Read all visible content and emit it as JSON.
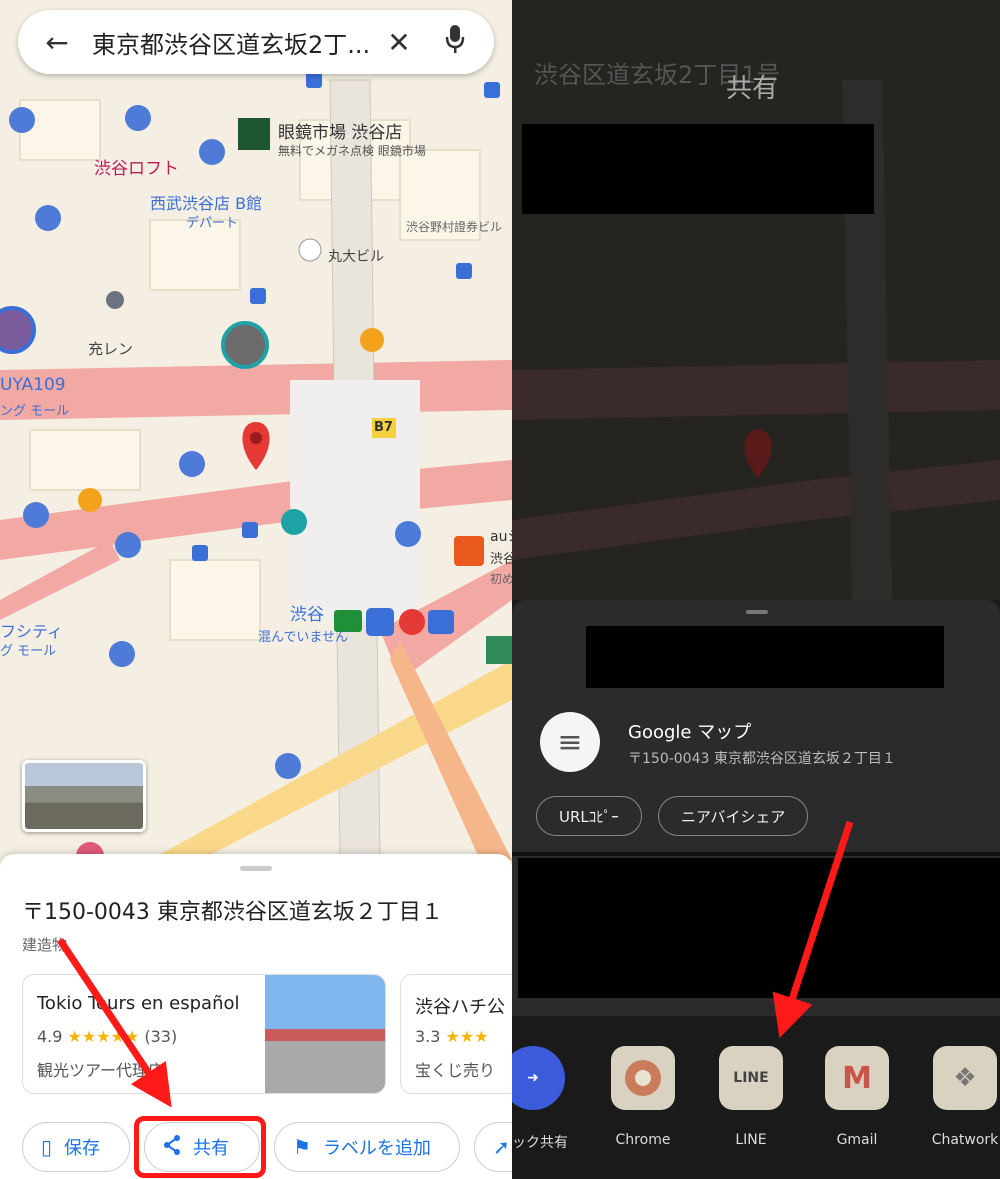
{
  "left": {
    "search": {
      "query": "東京都渋谷区道玄坂2丁...",
      "back_icon": "←",
      "clear_icon": "✕",
      "mic_icon": "🎙"
    },
    "map_labels": [
      "眼鏡市場 渋谷店",
      "無料でメガネ点検 眼鏡市場",
      "渋谷ロフト",
      "西武渋谷店 B館",
      "デパート",
      "丸大ビル",
      "渋谷野村證券ビル",
      "充レン",
      "UYA109",
      "ング モール",
      "B7",
      "auシティ店",
      "渋谷グス・会議取",
      "初めます",
      "渋谷",
      "混んでいません",
      "フシティ",
      "グ モール"
    ],
    "place": {
      "address": "〒150-0043 東京都渋谷区道玄坂２丁目１",
      "type": "建造物",
      "cards": [
        {
          "title": "Tokio Tours en español",
          "rating": "4.9",
          "stars": "★★★★★",
          "count": "(33)",
          "sub": "観光ツアー代理店"
        },
        {
          "title": "渋谷ハチ公",
          "rating": "3.3",
          "stars": "★★★",
          "sub": "宝くじ売り"
        }
      ],
      "actions": [
        {
          "label": "保存",
          "icon": "bookmark-icon"
        },
        {
          "label": "共有",
          "icon": "share-icon"
        },
        {
          "label": "ラベルを追加",
          "icon": "flag-icon"
        }
      ]
    }
  },
  "right": {
    "dim_search": "渋谷区道玄坂2丁目1号",
    "share_title": "共有",
    "share_sheet": {
      "app_title": "Google マップ",
      "app_sub": "〒150-0043 東京都渋谷区道玄坂２丁目１",
      "chips": [
        "URLｺﾋﾟｰ",
        "ニアバイシェア"
      ],
      "apps": [
        {
          "label": "イック共有",
          "icon": "quick-share-icon",
          "color": "#3b5bdb"
        },
        {
          "label": "Chrome",
          "icon": "chrome-icon",
          "color": "#d9d2c0"
        },
        {
          "label": "LINE",
          "icon": "line-icon",
          "color": "#d9d2c0"
        },
        {
          "label": "Gmail",
          "icon": "gmail-icon",
          "color": "#d9d2c0"
        },
        {
          "label": "Chatwork",
          "icon": "chatwork-icon",
          "color": "#d9d2c0"
        }
      ]
    }
  },
  "colors": {
    "highlight": "#ff1a1a",
    "accent_blue": "#1a73e8",
    "pin_red": "#e53935"
  }
}
